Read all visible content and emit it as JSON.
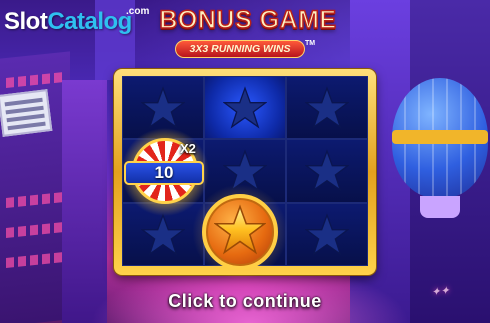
{
  "logo": {
    "part1": "Slot",
    "part2": "Catalog",
    "suffix": ".com"
  },
  "header": {
    "title": "BONUS GAME",
    "subtitle": "3X3 RUNNING WINS",
    "trademark": "TM"
  },
  "grid": {
    "rows": 3,
    "cols": 3,
    "cells": [
      {
        "symbol": "star-empty-icon",
        "lit": false
      },
      {
        "symbol": "star-empty-icon",
        "lit": true
      },
      {
        "symbol": "star-empty-icon",
        "lit": false
      },
      {
        "symbol": "bonus-coin",
        "lit": false
      },
      {
        "symbol": "star-empty-icon",
        "lit": false
      },
      {
        "symbol": "star-empty-icon",
        "lit": false
      },
      {
        "symbol": "star-empty-icon",
        "lit": false
      },
      {
        "symbol": "gold-star-coin",
        "lit": false
      },
      {
        "symbol": "star-empty-icon",
        "lit": false
      }
    ]
  },
  "feature_coin": {
    "value": "10",
    "multiplier": "X2"
  },
  "cta": {
    "label": "Click to continue"
  },
  "colors": {
    "frame_gold": "#e3a11e",
    "cell_blue": "#07104a",
    "title_red": "#b8201a",
    "logo_blue": "#2fc0f0"
  }
}
